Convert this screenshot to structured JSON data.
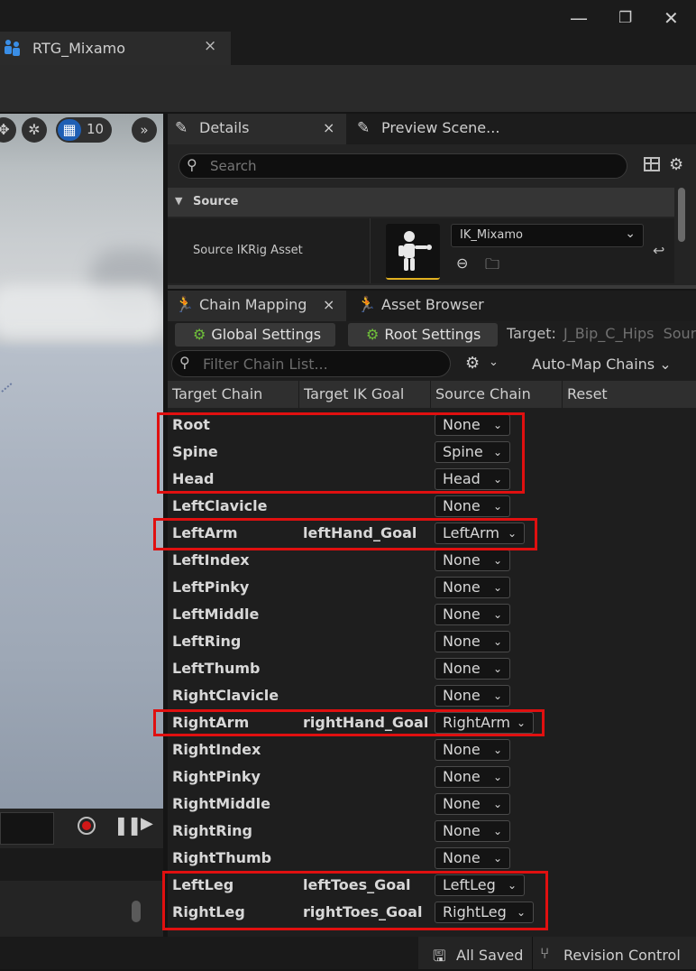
{
  "window": {
    "tab_title": "RTG_Mixamo",
    "tab_close": "×",
    "minimize": "—",
    "restore": "❐",
    "close": "✕"
  },
  "viewport": {
    "grid_value": "10",
    "more": "»"
  },
  "details": {
    "tab_label": "Details",
    "tab_close": "×",
    "preview_tab_label": "Preview Scene...",
    "search_placeholder": "Search",
    "section_title": "Source",
    "prop_label": "Source IKRig Asset",
    "asset_value": "IK_Mixamo"
  },
  "chain_mapping": {
    "tab_label": "Chain Mapping",
    "tab_close": "×",
    "asset_browser_tab": "Asset Browser",
    "global_settings": "Global Settings",
    "root_settings": "Root Settings",
    "target_label": "Target:",
    "target_value": "J_Bip_C_Hips  Sour",
    "filter_placeholder": "Filter Chain List...",
    "auto_map": "Auto-Map Chains ⌄",
    "columns": [
      "Target Chain",
      "Target IK Goal",
      "Source Chain",
      "Reset"
    ],
    "rows": [
      {
        "target": "Root",
        "goal": "",
        "source": "None"
      },
      {
        "target": "Spine",
        "goal": "",
        "source": "Spine"
      },
      {
        "target": "Head",
        "goal": "",
        "source": "Head"
      },
      {
        "target": "LeftClavicle",
        "goal": "",
        "source": "None"
      },
      {
        "target": "LeftArm",
        "goal": "leftHand_Goal",
        "source": "LeftArm"
      },
      {
        "target": "LeftIndex",
        "goal": "",
        "source": "None"
      },
      {
        "target": "LeftPinky",
        "goal": "",
        "source": "None"
      },
      {
        "target": "LeftMiddle",
        "goal": "",
        "source": "None"
      },
      {
        "target": "LeftRing",
        "goal": "",
        "source": "None"
      },
      {
        "target": "LeftThumb",
        "goal": "",
        "source": "None"
      },
      {
        "target": "RightClavicle",
        "goal": "",
        "source": "None"
      },
      {
        "target": "RightArm",
        "goal": "rightHand_Goal",
        "source": "RightArm"
      },
      {
        "target": "RightIndex",
        "goal": "",
        "source": "None"
      },
      {
        "target": "RightPinky",
        "goal": "",
        "source": "None"
      },
      {
        "target": "RightMiddle",
        "goal": "",
        "source": "None"
      },
      {
        "target": "RightRing",
        "goal": "",
        "source": "None"
      },
      {
        "target": "RightThumb",
        "goal": "",
        "source": "None"
      },
      {
        "target": "LeftLeg",
        "goal": "leftToes_Goal",
        "source": "LeftLeg"
      },
      {
        "target": "RightLeg",
        "goal": "rightToes_Goal",
        "source": "RightLeg"
      }
    ]
  },
  "statusbar": {
    "saved": "All Saved",
    "revision": "Revision Control"
  },
  "colors": {
    "highlight": "#e01010",
    "accent_blue": "#1f5fb4",
    "gear_green": "#6fbf3a"
  }
}
